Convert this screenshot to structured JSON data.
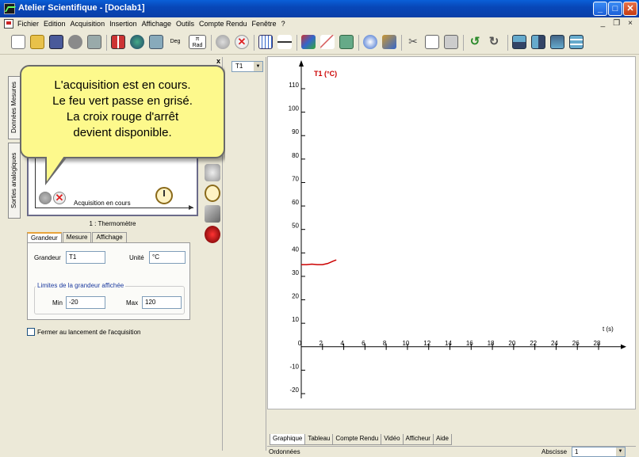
{
  "window": {
    "title": "Atelier Scientifique - [Doclab1]",
    "controls": {
      "minimize": "_",
      "maximize": "□",
      "close": "✕"
    }
  },
  "menu": {
    "items": [
      "Fichier",
      "Edition",
      "Acquisition",
      "Insertion",
      "Affichage",
      "Outils",
      "Compte Rendu",
      "Fenêtre",
      "?"
    ],
    "mdi": {
      "minimize": "_",
      "restore": "❐",
      "close": "×"
    }
  },
  "toolbar": {
    "deg_label": "Deg",
    "rad_label": "π\nRad"
  },
  "callout": {
    "lines": [
      "L'acquisition est en cours.",
      "Le feu vert passe en grisé.",
      "La croix rouge d'arrêt",
      "devient disponible."
    ]
  },
  "left_panel": {
    "close": "x",
    "vtabs": [
      "Données Mesures",
      "Sorties analogiques"
    ],
    "sensor_status": "Acquisition en cours",
    "sensor_title": "1 : Thermomètre",
    "tabs": [
      "Grandeur",
      "Mesure",
      "Affichage"
    ],
    "grandeur_label": "Grandeur",
    "grandeur_value": "T1",
    "unite_label": "Unité",
    "unite_value": "°C",
    "limits_title": "Limites de la grandeur affichée",
    "min_label": "Min",
    "min_value": "-20",
    "max_label": "Max",
    "max_value": "120",
    "close_on_start": "Fermer au lancement de l'acquisition"
  },
  "mid": {
    "sensor_select": "T1"
  },
  "bottom": {
    "tabs": [
      "Graphique",
      "Tableau",
      "Compte Rendu",
      "Vidéo",
      "Afficheur",
      "Aide"
    ],
    "ordonnees": "Ordonnées",
    "abscisse_label": "Abscisse",
    "abscisse_value": "1"
  },
  "chart_data": {
    "type": "line",
    "series": [
      {
        "name": "T1 (°C)",
        "color": "#cc0000",
        "x": [
          0,
          0.5,
          1,
          1.5,
          2,
          2.5,
          3,
          3.3
        ],
        "y": [
          35,
          35,
          35.2,
          35,
          35,
          35.5,
          36.5,
          37
        ]
      }
    ],
    "xlabel": "t (s)",
    "ylabel": "T1 (°C)",
    "xlim": [
      0,
      28
    ],
    "ylim": [
      -20,
      110
    ],
    "xticks": [
      0,
      2,
      4,
      6,
      8,
      10,
      12,
      14,
      16,
      18,
      20,
      22,
      24,
      26,
      28
    ],
    "yticks": [
      -20,
      -10,
      0,
      10,
      20,
      30,
      40,
      50,
      60,
      70,
      80,
      90,
      100,
      110
    ],
    "grid": false
  }
}
